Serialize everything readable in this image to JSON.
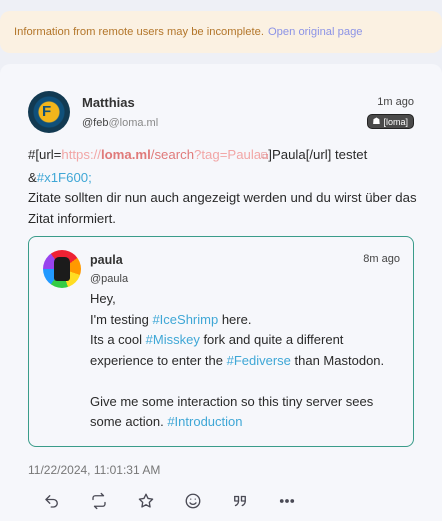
{
  "banner": {
    "text": "Information from remote users may be incomplete.",
    "link": "Open original page"
  },
  "note": {
    "author": {
      "name": "Matthias",
      "username": "@feb",
      "host": "@loma.ml",
      "avatar_icon": "federation-logo-avatar"
    },
    "time": "1m ago",
    "instance_badge": "[loma]",
    "body": {
      "line1_prefix": "#[url=",
      "url_scheme": "https://",
      "url_host": "loma.ml",
      "url_path": "/search",
      "url_query": "?tag=Paula",
      "line1_suffix": "]Paula[/url] testet",
      "line2_prefix": "&",
      "line2_tag": "#x1F600;",
      "line3": "Zitate sollten dir nun auch angezeigt werden und du wirst über das Zitat informiert."
    },
    "quote": {
      "author": {
        "name": "paula",
        "username": "@paula",
        "avatar_icon": "rainbow-fist-avatar"
      },
      "time": "8m ago",
      "lines": {
        "l1": "Hey,",
        "l2_prefix": "I'm testing ",
        "l2_tag": "#IceShrimp",
        "l2_suffix": " here.",
        "l3_prefix": "Its a cool ",
        "l3_tag": "#Misskey",
        "l3_suffix": " fork and quite a different",
        "l4_prefix": "experience to enter the ",
        "l4_tag": "#Fediverse",
        "l4_suffix": " than Mastodon.",
        "l5": "Give me some interaction so this tiny server sees",
        "l6_prefix": "some action. ",
        "l6_tag": "#Introduction"
      }
    },
    "date": "11/22/2024, 11:01:31 AM",
    "actions": [
      "reply-icon",
      "boost-icon",
      "star-icon",
      "emoji-reaction-icon",
      "quote-icon",
      "more-icon"
    ]
  },
  "colors": {
    "accent_link": "#8c93e6",
    "hashtag": "#3fa7d6",
    "quote_border": "#3a9c8a",
    "warning_text": "#b3762a"
  }
}
